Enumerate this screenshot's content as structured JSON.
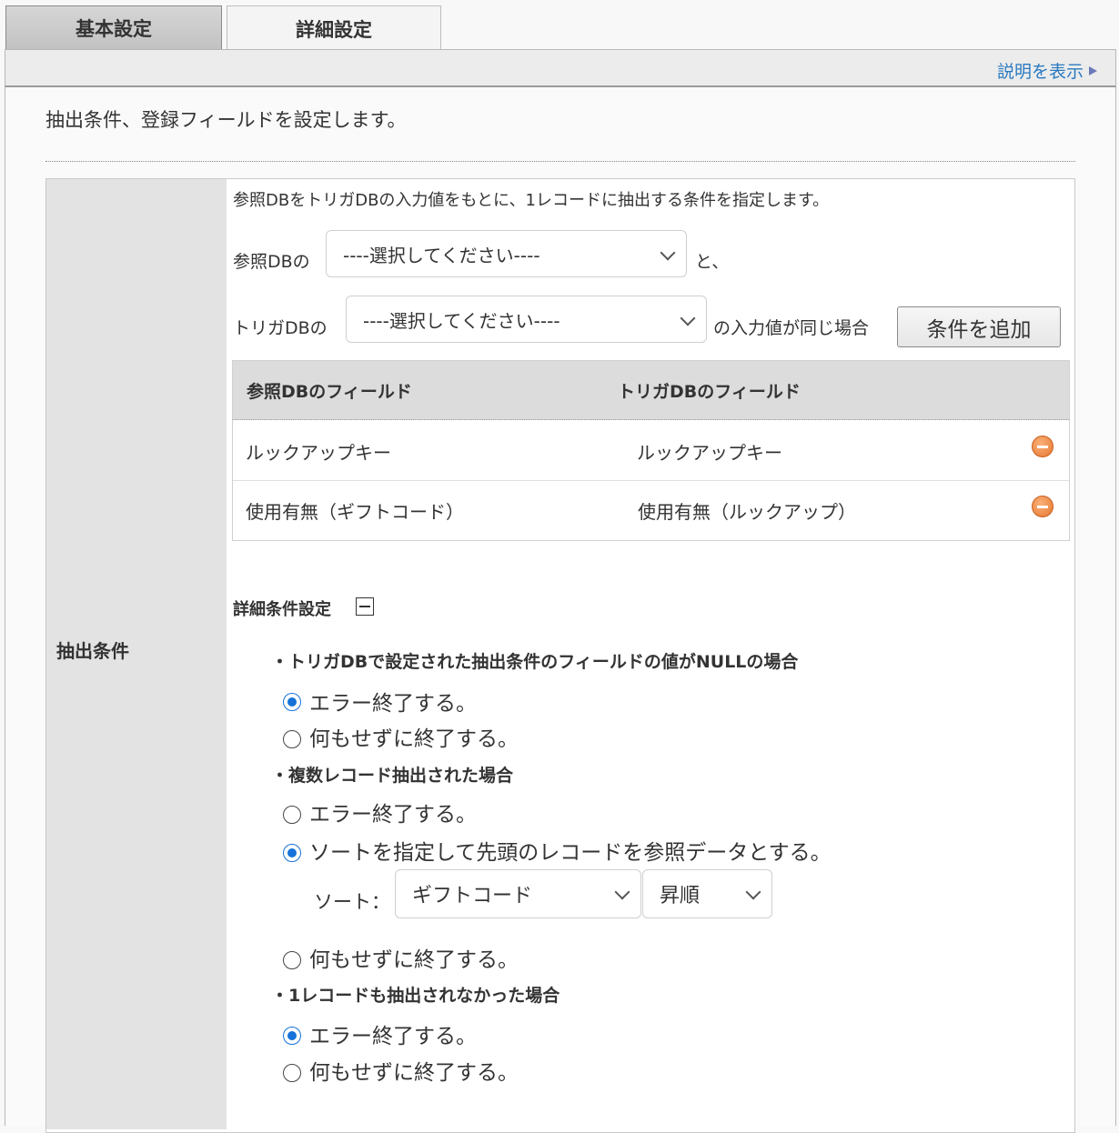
{
  "tabs": [
    {
      "label": "基本設定"
    },
    {
      "label": "詳細設定"
    }
  ],
  "help_link": "説明を表示",
  "intro": "抽出条件、登録フィールドを設定します。",
  "section": {
    "label": "抽出条件",
    "description": "参照DBをトリガDBの入力値をもとに、1レコードに抽出する条件を指定します。",
    "ref_db_prefix": "参照DBの",
    "ref_db_select": "----選択してください----",
    "ref_db_suffix": "と、",
    "trigger_db_prefix": "トリガDBの",
    "trigger_db_select": "----選択してください----",
    "trigger_db_suffix": "の入力値が同じ場合",
    "add_button": "条件を追加"
  },
  "condition_table": {
    "headers": [
      "参照DBのフィールド",
      "トリガDBのフィールド"
    ],
    "rows": [
      {
        "ref": "ルックアップキー",
        "trigger": "ルックアップキー"
      },
      {
        "ref": "使用有無（ギフトコード）",
        "trigger": "使用有無（ルックアップ）"
      }
    ]
  },
  "detail": {
    "title": "詳細条件設定",
    "groups": [
      {
        "heading": "・トリガDBで設定された抽出条件のフィールドの値がNULLの場合",
        "options": [
          {
            "label": "エラー終了する。",
            "checked": true
          },
          {
            "label": "何もせずに終了する。",
            "checked": false
          }
        ]
      },
      {
        "heading": "・複数レコード抽出された場合",
        "options": [
          {
            "label": "エラー終了する。",
            "checked": false
          },
          {
            "label": "ソートを指定して先頭のレコードを参照データとする。",
            "checked": true
          },
          {
            "label": "何もせずに終了する。",
            "checked": false
          }
        ],
        "sort_label": "ソート：",
        "sort_field": "ギフトコード",
        "sort_order": "昇順"
      },
      {
        "heading": "・1レコードも抽出されなかった場合",
        "options": [
          {
            "label": "エラー終了する。",
            "checked": true
          },
          {
            "label": "何もせずに終了する。",
            "checked": false
          }
        ]
      }
    ]
  },
  "colors": {
    "accent": "#1672d8",
    "link": "#2a7ac0",
    "remove": "#e6772f"
  }
}
